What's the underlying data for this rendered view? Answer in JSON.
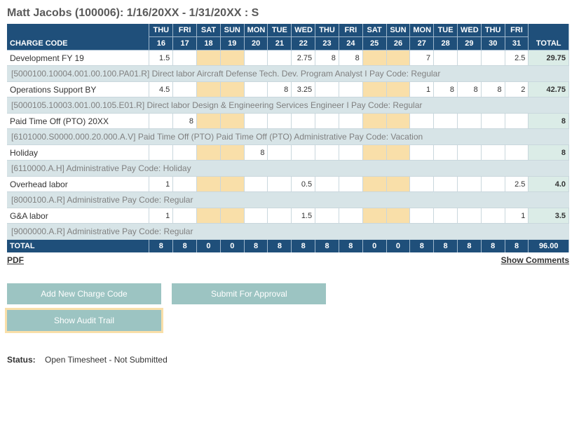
{
  "title": "Matt Jacobs (100006): 1/16/20XX - 1/31/20XX : S",
  "header": {
    "chargeCode": "CHARGE CODE",
    "days": [
      {
        "dow": "THU",
        "num": "16",
        "nw": false
      },
      {
        "dow": "FRI",
        "num": "17",
        "nw": false
      },
      {
        "dow": "SAT",
        "num": "18",
        "nw": true
      },
      {
        "dow": "SUN",
        "num": "19",
        "nw": true
      },
      {
        "dow": "MON",
        "num": "20",
        "nw": false
      },
      {
        "dow": "TUE",
        "num": "21",
        "nw": false
      },
      {
        "dow": "WED",
        "num": "22",
        "nw": false
      },
      {
        "dow": "THU",
        "num": "23",
        "nw": false
      },
      {
        "dow": "FRI",
        "num": "24",
        "nw": false
      },
      {
        "dow": "SAT",
        "num": "25",
        "nw": true
      },
      {
        "dow": "SUN",
        "num": "26",
        "nw": true
      },
      {
        "dow": "MON",
        "num": "27",
        "nw": false
      },
      {
        "dow": "TUE",
        "num": "28",
        "nw": false
      },
      {
        "dow": "WED",
        "num": "29",
        "nw": false
      },
      {
        "dow": "THU",
        "num": "30",
        "nw": false
      },
      {
        "dow": "FRI",
        "num": "31",
        "nw": false
      }
    ],
    "total": "TOTAL"
  },
  "rows": [
    {
      "label": "Development FY 19",
      "hours": [
        "1.5",
        "",
        "",
        "",
        "",
        "",
        "2.75",
        "8",
        "8",
        "",
        "",
        "7",
        "",
        "",
        "",
        "2.5"
      ],
      "total": "29.75",
      "desc": "[5000100.10004.001.00.100.PA01.R]   Direct labor    Aircraft Defense Tech. Dev.    Program Analyst I    Pay Code: Regular"
    },
    {
      "label": "Operations Support BY",
      "hours": [
        "4.5",
        "",
        "",
        "",
        "",
        "8",
        "3.25",
        "",
        "",
        "",
        "",
        "1",
        "8",
        "8",
        "8",
        "2"
      ],
      "total": "42.75",
      "desc": "[5000105.10003.001.00.105.E01.R]   Direct labor    Design & Engineering Services    Engineer I    Pay Code: Regular"
    },
    {
      "label": "Paid Time Off (PTO) 20XX",
      "hours": [
        "",
        "8",
        "",
        "",
        "",
        "",
        "",
        "",
        "",
        "",
        "",
        "",
        "",
        "",
        "",
        ""
      ],
      "total": "8",
      "desc": "[6101000.S0000.000.20.000.A.V]   Paid Time Off (PTO)    Paid Time Off (PTO)    Administrative    Pay Code: Vacation"
    },
    {
      "label": "Holiday",
      "hours": [
        "",
        "",
        "",
        "",
        "8",
        "",
        "",
        "",
        "",
        "",
        "",
        "",
        "",
        "",
        "",
        ""
      ],
      "total": "8",
      "desc": "[6110000.A.H]   Administrative    Pay Code: Holiday"
    },
    {
      "label": "Overhead labor",
      "hours": [
        "1",
        "",
        "",
        "",
        "",
        "",
        "0.5",
        "",
        "",
        "",
        "",
        "",
        "",
        "",
        "",
        "2.5"
      ],
      "total": "4.0",
      "desc": "[8000100.A.R]   Administrative    Pay Code: Regular"
    },
    {
      "label": "G&A labor",
      "hours": [
        "1",
        "",
        "",
        "",
        "",
        "",
        "1.5",
        "",
        "",
        "",
        "",
        "",
        "",
        "",
        "",
        "1"
      ],
      "total": "3.5",
      "desc": "[9000000.A.R]   Administrative    Pay Code: Regular"
    }
  ],
  "totals": {
    "label": "TOTAL",
    "hours": [
      "8",
      "8",
      "0",
      "0",
      "8",
      "8",
      "8",
      "8",
      "8",
      "0",
      "0",
      "8",
      "8",
      "8",
      "8",
      "8"
    ],
    "total": "96.00"
  },
  "links": {
    "pdf": "PDF",
    "showComments": "Show Comments"
  },
  "buttons": {
    "addCharge": "Add New Charge Code",
    "submit": "Submit For Approval",
    "audit": "Show Audit Trail"
  },
  "status": {
    "label": "Status:",
    "value": "Open Timesheet - Not Submitted"
  }
}
